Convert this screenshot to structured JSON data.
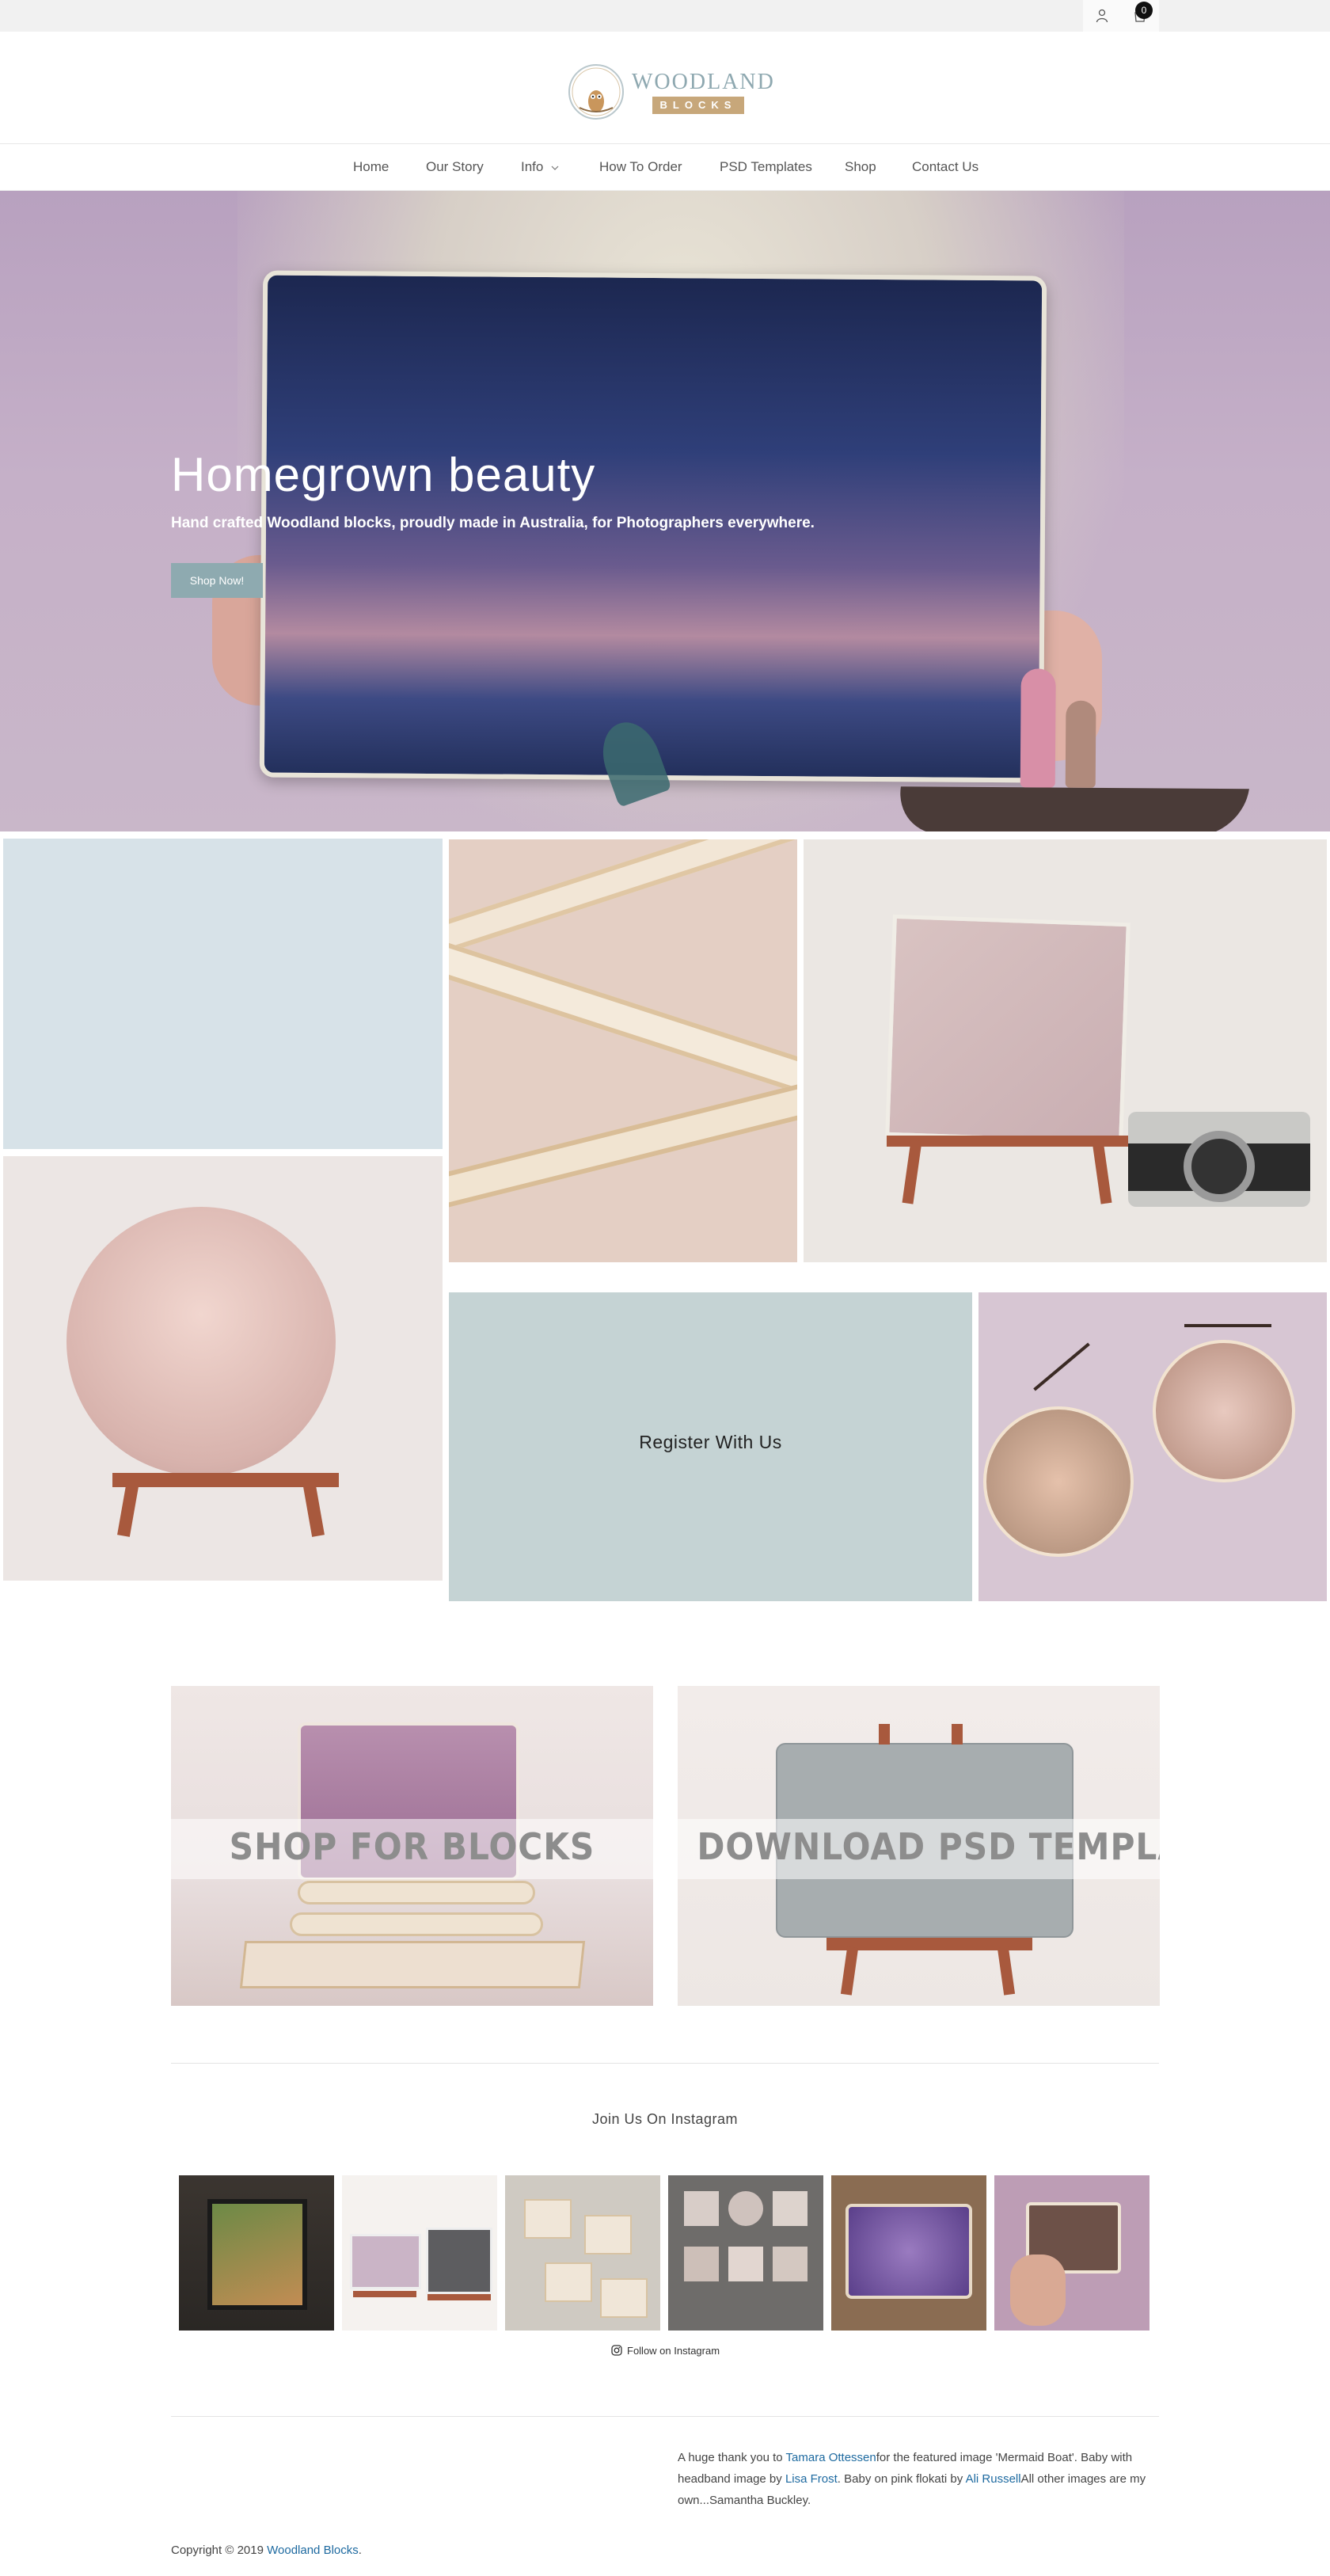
{
  "topbar": {
    "account_icon": "user-icon",
    "cart_icon": "cart-icon",
    "cart_count": "0"
  },
  "logo": {
    "word": "WOODLAND",
    "sub": "BLOCKS",
    "icon": "owl-icon"
  },
  "nav": {
    "items": [
      {
        "label": "Home"
      },
      {
        "label": "Our Story"
      },
      {
        "label": "Info"
      },
      {
        "label": "How To Order"
      },
      {
        "label": "PSD Templates"
      },
      {
        "label": "Shop"
      },
      {
        "label": "Contact Us"
      }
    ],
    "dropdown_icon": "chevron-down-icon"
  },
  "hero": {
    "title": "Homegrown beauty",
    "subtitle": "Hand crafted Woodland blocks, proudly made in Australia, for Photographers everywhere.",
    "button": "Shop Now!"
  },
  "gallery": {
    "register_label": "Register With Us"
  },
  "cards": {
    "shop_label": "SHOP FOR BLOCKS",
    "psd_label": "DOWNLOAD PSD TEMPLATES"
  },
  "instagram": {
    "title": "Join Us On Instagram",
    "follow_label": "Follow on Instagram",
    "follow_icon": "instagram-icon"
  },
  "credits": {
    "part1": "A huge thank you to ",
    "link1": "Tamara Ottessen",
    "part2": "for the featured image 'Mermaid Boat'. Baby with headband image by ",
    "link2": "Lisa Frost",
    "part3": ". Baby on pink flokati by ",
    "link3": "Ali Russell",
    "part4": "All other images are my own...Samantha Buckley."
  },
  "footer": {
    "copyright_prefix": "Copyright © 2019 ",
    "copyright_link": "Woodland Blocks",
    "copyright_suffix": "."
  },
  "colors": {
    "accent": "#8eaab0",
    "link": "#1e6aa0",
    "logo_gold": "#c7a77a"
  }
}
